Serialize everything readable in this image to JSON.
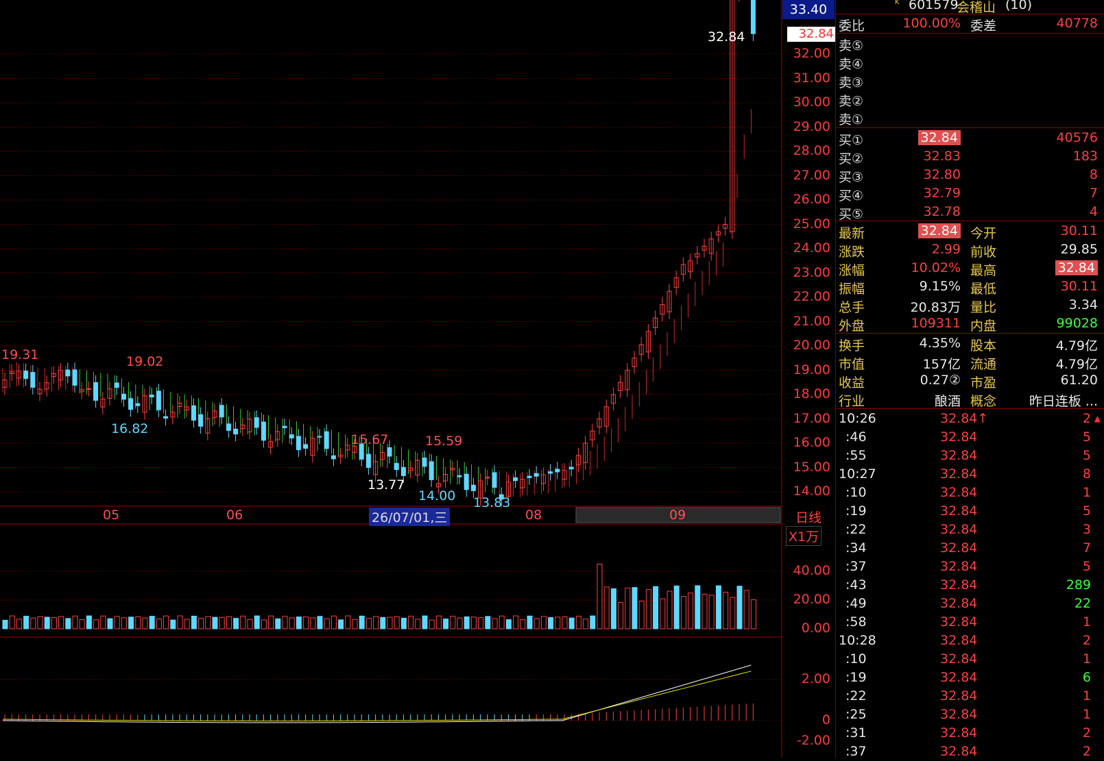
{
  "header": {
    "code": "601579",
    "name": "会稽山",
    "suffix": "(10)",
    "top_price": "33.40",
    "mark": "K"
  },
  "weibi": {
    "label": "委比",
    "value": "100.00%",
    "diff_label": "委差",
    "diff_value": "40778"
  },
  "sell": [
    {
      "label": "卖⑤"
    },
    {
      "label": "卖④"
    },
    {
      "label": "卖③"
    },
    {
      "label": "卖②"
    },
    {
      "label": "卖①"
    }
  ],
  "buy": [
    {
      "label": "买①",
      "price": "32.84",
      "vol": "40576"
    },
    {
      "label": "买②",
      "price": "32.83",
      "vol": "183"
    },
    {
      "label": "买③",
      "price": "32.80",
      "vol": "8"
    },
    {
      "label": "买④",
      "price": "32.79",
      "vol": "7"
    },
    {
      "label": "买⑤",
      "price": "32.78",
      "vol": "4"
    }
  ],
  "quote": [
    {
      "l1": "最新",
      "v1": "32.84",
      "l2": "今开",
      "v2": "30.11"
    },
    {
      "l1": "涨跌",
      "v1": "2.99",
      "l2": "前收",
      "v2": "29.85"
    },
    {
      "l1": "涨幅",
      "v1": "10.02%",
      "l2": "最高",
      "v2": "32.84"
    },
    {
      "l1": "振幅",
      "v1": "9.15%",
      "l2": "最低",
      "v2": "30.11"
    },
    {
      "l1": "总手",
      "v1": "20.83万",
      "l2": "量比",
      "v2": "3.34"
    },
    {
      "l1": "外盘",
      "v1": "109311",
      "l2": "内盘",
      "v2": "99028"
    }
  ],
  "fundamentals": [
    {
      "l1": "换手",
      "v1": "4.35%",
      "l2": "股本",
      "v2": "4.79亿"
    },
    {
      "l1": "市值",
      "v1": "157亿",
      "l2": "流通",
      "v2": "4.79亿"
    },
    {
      "l1": "收益",
      "v1": "0.27②",
      "l2": "市盈",
      "v2": "61.20"
    },
    {
      "l1": "行业",
      "v1": "酿酒",
      "l2": "概念",
      "v2": "昨日连板 ..."
    }
  ],
  "ticks": [
    {
      "t": "10:26",
      "p": "32.84↑",
      "v": "2",
      "c": "red"
    },
    {
      "t": ":46",
      "p": "32.84",
      "v": "5",
      "c": "red"
    },
    {
      "t": ":55",
      "p": "32.84",
      "v": "5",
      "c": "red"
    },
    {
      "t": "10:27",
      "p": "32.84",
      "v": "8",
      "c": "red"
    },
    {
      "t": ":10",
      "p": "32.84",
      "v": "1",
      "c": "red"
    },
    {
      "t": ":19",
      "p": "32.84",
      "v": "5",
      "c": "red"
    },
    {
      "t": ":22",
      "p": "32.84",
      "v": "3",
      "c": "red"
    },
    {
      "t": ":34",
      "p": "32.84",
      "v": "7",
      "c": "red"
    },
    {
      "t": ":37",
      "p": "32.84",
      "v": "5",
      "c": "red"
    },
    {
      "t": ":43",
      "p": "32.84",
      "v": "289",
      "c": "green"
    },
    {
      "t": ":49",
      "p": "32.84",
      "v": "22",
      "c": "green"
    },
    {
      "t": ":58",
      "p": "32.84",
      "v": "1",
      "c": "red"
    },
    {
      "t": "10:28",
      "p": "32.84",
      "v": "2",
      "c": "red"
    },
    {
      "t": ":10",
      "p": "32.84",
      "v": "1",
      "c": "red"
    },
    {
      "t": ":19",
      "p": "32.84",
      "v": "6",
      "c": "green"
    },
    {
      "t": ":22",
      "p": "32.84",
      "v": "1",
      "c": "red"
    },
    {
      "t": ":25",
      "p": "32.84",
      "v": "1",
      "c": "red"
    },
    {
      "t": ":31",
      "p": "32.84",
      "v": "2",
      "c": "red"
    },
    {
      "t": ":37",
      "p": "32.84",
      "v": "2",
      "c": "red"
    }
  ],
  "price_axis": [
    "32.84",
    "32.00",
    "31.00",
    "30.00",
    "29.00",
    "28.00",
    "27.00",
    "26.00",
    "25.00",
    "24.00",
    "23.00",
    "22.00",
    "21.00",
    "20.00",
    "19.00",
    "18.00",
    "17.00",
    "16.00",
    "15.00",
    "14.00"
  ],
  "vol_axis": [
    "40.00",
    "20.00",
    "0.00"
  ],
  "macd_axis": [
    "2.00",
    "0",
    "-2.00"
  ],
  "x_labels": [
    {
      "text": "05"
    },
    {
      "text": "06"
    },
    {
      "text": "26/07/01,三"
    },
    {
      "text": "08"
    },
    {
      "text": "09"
    }
  ],
  "period": "日线",
  "vol_unit": "X1万",
  "annotations": [
    "19.31",
    "19.02",
    "16.82",
    "15.67",
    "15.59",
    "13.77",
    "14.00",
    "13.83",
    "32.84"
  ],
  "colors": {
    "up": "#ff4040",
    "down": "#5fd8ff",
    "grid": "#7a0000",
    "green_band": "#3cff3c",
    "red_band": "#ff3030"
  }
}
